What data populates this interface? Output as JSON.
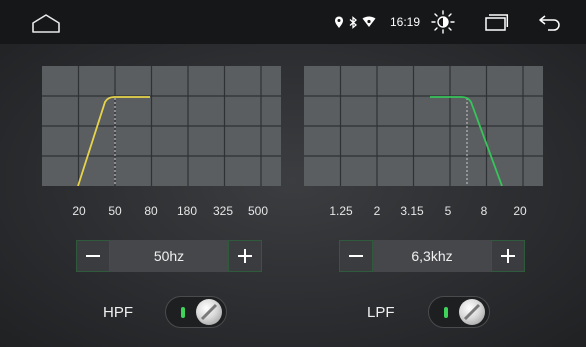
{
  "status_bar": {
    "time": "16:19",
    "icons": [
      "home-icon",
      "location-icon",
      "bluetooth-icon",
      "wifi-icon",
      "brightness-icon",
      "recent-apps-icon",
      "back-icon"
    ]
  },
  "hpf": {
    "ticks": [
      "20",
      "50",
      "80",
      "180",
      "325",
      "500"
    ],
    "value": "50hz",
    "label": "HPF",
    "enabled": true,
    "curve_color": "#e7d44a"
  },
  "lpf": {
    "ticks": [
      "1.25",
      "2",
      "3.15",
      "5",
      "8",
      "20"
    ],
    "value": "6,3khz",
    "label": "LPF",
    "enabled": true,
    "curve_color": "#37c45a"
  },
  "colors": {
    "graph_bg": "#5b5e61",
    "grid": "#2f3134",
    "stepper_border": "#2f5a3c",
    "toggle_indicator": "#3fd35a"
  }
}
